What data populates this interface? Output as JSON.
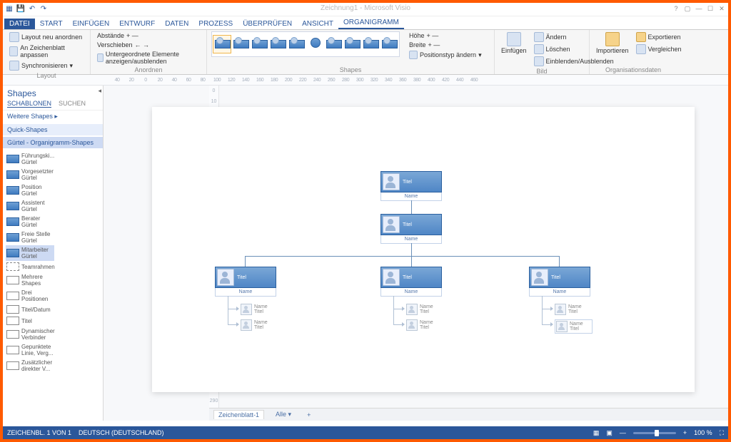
{
  "titlebar": {
    "title": "Zeichnung1 - Microsoft Visio"
  },
  "tabs": [
    "DATEI",
    "START",
    "EINFÜGEN",
    "ENTWURF",
    "DATEN",
    "PROZESS",
    "ÜBERPRÜFEN",
    "ANSICHT",
    "ORGANIGRAMM"
  ],
  "active_tab": 8,
  "ribbon": {
    "layout": {
      "label": "Layout",
      "neu": "Layout neu anordnen",
      "fit": "An Zeichenblatt anpassen",
      "sync": "Synchronisieren"
    },
    "anordnen": {
      "label": "Anordnen",
      "abst": "Abstände",
      "versch": "Verschieben",
      "unter": "Untergeordnete Elemente anzeigen/ausblenden"
    },
    "shapes": {
      "label": "Shapes",
      "hohe": "Höhe",
      "breite": "Breite",
      "pos": "Positionstyp ändern"
    },
    "bild": {
      "label": "Bild",
      "einf": "Einfügen",
      "andern": "Ändern",
      "loschen": "Löschen",
      "einaus": "Einblenden/Ausblenden"
    },
    "orgdata": {
      "label": "Organisationsdaten",
      "imp": "Importieren",
      "exp": "Exportieren",
      "verg": "Vergleichen"
    }
  },
  "sidebar": {
    "title": "Shapes",
    "tab_schab": "SCHABLONEN",
    "tab_suchen": "SUCHEN",
    "weitere": "Weitere Shapes  ▸",
    "quick": "Quick-Shapes",
    "cat": "Gürtel - Organigramm-Shapes",
    "items": [
      {
        "l": "Führungski... Gürtel"
      },
      {
        "l": "Vorgesetzter Gürtel"
      },
      {
        "l": "Position Gürtel"
      },
      {
        "l": "Assistent Gürtel"
      },
      {
        "l": "Berater Gürtel"
      },
      {
        "l": "Freie Stelle Gürtel"
      },
      {
        "l": "Mitarbeiter Gürtel",
        "sel": true
      },
      {
        "l": "Teamrahmen",
        "alt": true
      },
      {
        "l": "Mehrere Shapes",
        "icon": true
      },
      {
        "l": "Drei Positionen",
        "icon": true
      },
      {
        "l": "Titel/Datum",
        "icon": true
      },
      {
        "l": "Titel",
        "icon": true
      },
      {
        "l": "Dynamischer Verbinder",
        "icon": true
      },
      {
        "l": "Gepunktete Linie, Verg...",
        "icon": true
      },
      {
        "l": "Zusätzlicher direkter V...",
        "icon": true
      }
    ]
  },
  "node": {
    "role": "Titel",
    "name": "Name"
  },
  "sub": {
    "name": "Name",
    "title": "Titel"
  },
  "pagetabs": {
    "p1": "Zeichenblatt-1",
    "all": "Alle ▾",
    "add": "+"
  },
  "status": {
    "page": "ZEICHENBL. 1 VON 1",
    "lang": "DEUTSCH (DEUTSCHLAND)",
    "zoom": "100 %"
  }
}
